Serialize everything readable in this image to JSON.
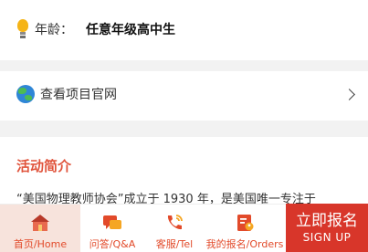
{
  "age": {
    "icon": "lightbulb-icon",
    "label": "年龄：",
    "value": "任意年级高中生"
  },
  "website": {
    "icon": "globe-icon",
    "label": "查看项目官网",
    "chevron_icon": "chevron-right-icon"
  },
  "intro": {
    "title": "活动简介",
    "text": "“美国物理教师协会”成立于 1930 年，是美国唯一专注于"
  },
  "tabbar": {
    "tabs": [
      {
        "label": "首页/Home",
        "icon": "home-icon"
      },
      {
        "label": "问答/Q&A",
        "icon": "chat-bubble-icon"
      },
      {
        "label": "客服/Tel",
        "icon": "phone-icon"
      },
      {
        "label": "我的报名/Orders",
        "icon": "orders-icon"
      }
    ],
    "signup": {
      "label_cn": "立即报名",
      "label_en": "SIGN UP"
    }
  },
  "colors": {
    "accent": "#e0533b",
    "tab_text": "#e24a2a",
    "signup_bg": "#d8362a",
    "active_tab_bg": "#f7e3dc",
    "page_bg": "#f2f2f2"
  }
}
